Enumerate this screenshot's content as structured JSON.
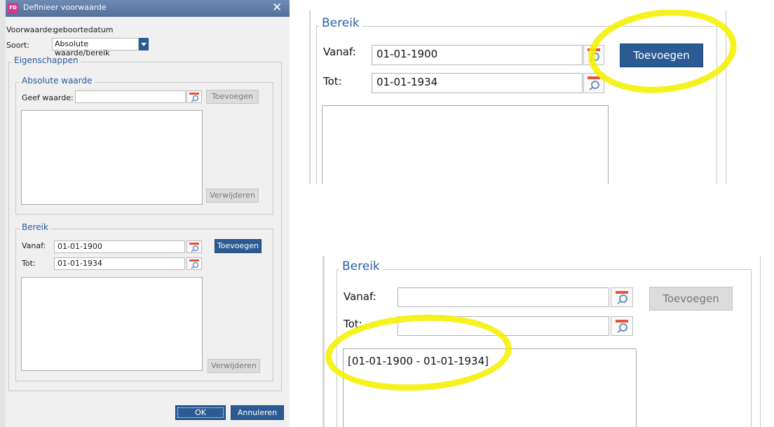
{
  "dialog": {
    "title": "Definieer voorwaarde",
    "close_glyph": "✕",
    "voorwaarde_label": "Voorwaarde:",
    "voorwaarde_value": "geboortedatum",
    "soort_label": "Soort:",
    "soort_value": "Absolute waarde/bereik",
    "eigenschappen": "Eigenschappen",
    "absolute": {
      "legend": "Absolute waarde",
      "label": "Geef waarde:",
      "value": "",
      "add": "Toevoegen",
      "remove": "Verwijderen"
    },
    "bereik": {
      "legend": "Bereik",
      "vanaf_label": "Vanaf:",
      "vanaf_value": "01-01-1900",
      "tot_label": "Tot:",
      "tot_value": "01-01-1934",
      "add": "Toevoegen",
      "remove": "Verwijderen"
    },
    "ok": "OK",
    "cancel": "Annuleren"
  },
  "zoom_top": {
    "legend": "Bereik",
    "vanaf_label": "Vanaf:",
    "vanaf_value": "01-01-1900",
    "tot_label": "Tot:",
    "tot_value": "01-01-1934",
    "add": "Toevoegen"
  },
  "zoom_bottom": {
    "legend": "Bereik",
    "vanaf_label": "Vanaf:",
    "vanaf_value": "",
    "tot_label": "Tot:",
    "tot_value": "",
    "add": "Toevoegen",
    "list_items": [
      "[01-01-1900 - 01-01-1934]"
    ]
  },
  "icons": {
    "lookup": "calendar-search-icon",
    "dropdown": "chevron-down-icon",
    "close": "close-icon"
  },
  "colors": {
    "accent": "#2c5b94",
    "legend": "#2a62a8",
    "highlight": "#f5f000"
  }
}
